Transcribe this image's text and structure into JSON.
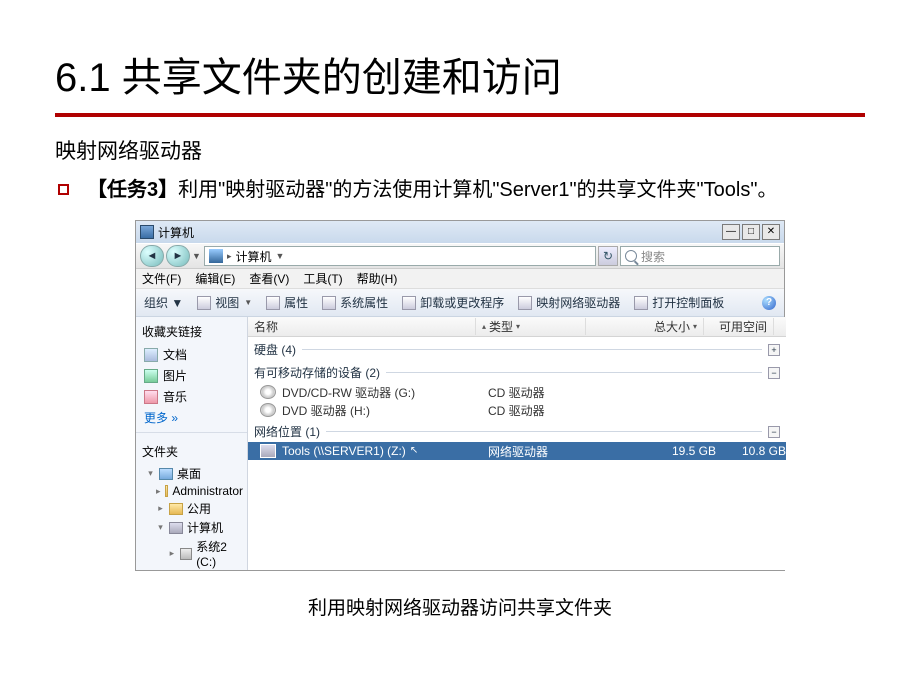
{
  "slide": {
    "title": "6.1  共享文件夹的创建和访问",
    "subtitle": "映射网络驱动器",
    "task_label": "【任务3】",
    "task_text": "利用\"映射驱动器\"的方法使用计算机\"Server1\"的共享文件夹\"Tools\"。",
    "caption": "利用映射网络驱动器访问共享文件夹"
  },
  "win": {
    "title": "计算机",
    "breadcrumb": "计算机",
    "breadcrumb_suffix": "▼",
    "search_placeholder": "搜索",
    "menus": [
      "文件(F)",
      "编辑(E)",
      "查看(V)",
      "工具(T)",
      "帮助(H)"
    ],
    "toolbar": {
      "organize": "组织 ▼",
      "views": "视图",
      "properties": "属性",
      "sysprops": "系统属性",
      "uninstall": "卸载或更改程序",
      "mapdrive": "映射网络驱动器",
      "controlpanel": "打开控制面板"
    },
    "sidebar": {
      "fav_title": "收藏夹链接",
      "items": [
        "文档",
        "图片",
        "音乐"
      ],
      "more": "更多  »",
      "folders_title": "文件夹",
      "tree": [
        "桌面",
        "Administrator",
        "公用",
        "计算机",
        "系统2 (C:)"
      ]
    },
    "columns": {
      "name": "名称",
      "type": "类型",
      "size": "总大小",
      "free": "可用空间"
    },
    "groups": {
      "hdd": "硬盘 (4)",
      "removable": "有可移动存储的设备 (2)",
      "netloc": "网络位置 (1)"
    },
    "rows": {
      "dvd1_name": "DVD/CD-RW 驱动器 (G:)",
      "dvd1_type": "CD 驱动器",
      "dvd2_name": "DVD 驱动器 (H:)",
      "dvd2_type": "CD 驱动器",
      "net_name": "Tools (\\\\SERVER1) (Z:)",
      "net_type": "网络驱动器",
      "net_size": "19.5 GB",
      "net_free": "10.8 GB"
    }
  }
}
